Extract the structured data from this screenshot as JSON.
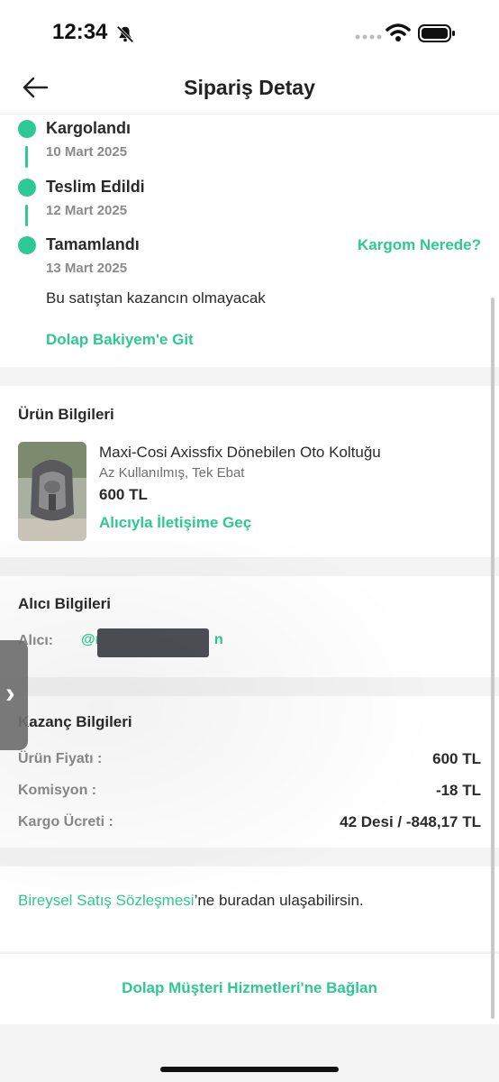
{
  "status_bar": {
    "time": "12:34",
    "icons": [
      "bell-off-icon",
      "signal-dots-icon",
      "wifi-icon",
      "battery-icon"
    ]
  },
  "nav": {
    "title": "Sipariş Detay",
    "back_icon": "back-arrow-icon"
  },
  "timeline": [
    {
      "title": "Kargolandı",
      "date": "10 Mart 2025"
    },
    {
      "title": "Teslim Edildi",
      "date": "12 Mart 2025"
    },
    {
      "title": "Tamamlandı",
      "date": "13 Mart 2025"
    }
  ],
  "where_link": "Kargom Nerede?",
  "no_earnings": "Bu satıştan kazancın olmayacak",
  "balance_link": "Dolap Bakiyem'e Git",
  "product_section": {
    "title": "Ürün Bilgileri",
    "name": "Maxi-Cosi Axissfix Dönebilen Oto Koltuğu",
    "condition": "Az Kullanılmış,  Tek Ebat",
    "price": "600 TL",
    "contact_link": "Alıcıyla İletişime Geç"
  },
  "buyer_section": {
    "title": "Alıcı Bilgileri",
    "label": "Alıcı:",
    "handle_prefix": "@r",
    "handle_suffix": "n"
  },
  "earnings_section": {
    "title": "Kazanç Bilgileri",
    "rows": [
      {
        "label": "Ürün Fiyatı :",
        "value": "600 TL"
      },
      {
        "label": "Komisyon :",
        "value": "-18 TL"
      },
      {
        "label": "Kargo Ücreti :",
        "value": "42 Desi / -848,17 TL"
      }
    ]
  },
  "contract": {
    "link": "Bireysel Satış Sözleşmesi",
    "rest": "’ne buradan ulaşabilirsin."
  },
  "customer_service_link": "Dolap Müşteri Hizmetleri'ne Bağlan",
  "colors": {
    "accent": "#2dc896",
    "section_gap": "#f3f3f3",
    "text": "#2a2a2a",
    "muted": "#8a8a8a"
  }
}
